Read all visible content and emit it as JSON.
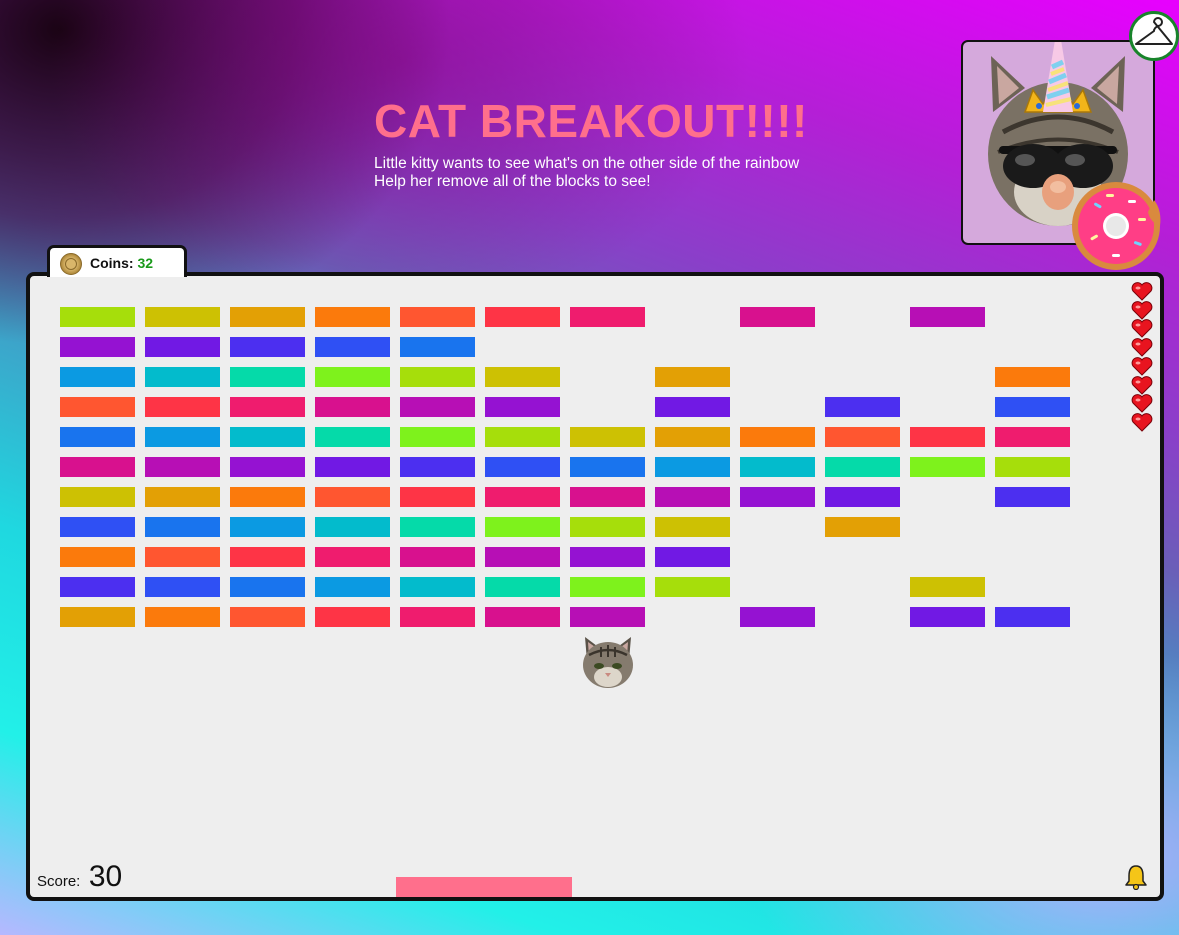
{
  "header": {
    "title": "CAT BREAKOUT!!!!",
    "subtitle_lines": [
      "Little kitty wants to see what's on the other side of the rainbow",
      "Help her remove all of the blocks to see!"
    ]
  },
  "portrait": {
    "icon": "unicorn-cat-icon",
    "bg_color": "#d5a9dc"
  },
  "wardrobe_button": {
    "icon": "hanger-icon",
    "border_color": "#18842b"
  },
  "donut": {
    "icon": "donut-icon"
  },
  "coins": {
    "label": "Coins:",
    "count": "32",
    "icon": "coin-icon",
    "count_color": "#1a9a1a"
  },
  "game": {
    "ball": {
      "icon": "cat-face-icon"
    },
    "paddle_color": "#ff6f8c",
    "lives": 8,
    "score_label": "Score:",
    "score": "30",
    "sound_icon": "bell-icon",
    "bricks": [
      [
        "#a6de0b",
        "#cdc103",
        "#e3a005",
        "#fb7a0c",
        "#ff5630",
        "#fe3446",
        "#ef1c6e",
        null,
        "#d8118e",
        null,
        "#b70fb5",
        null
      ],
      [
        "#9512d2",
        "#7119e4",
        "#4c2ff0",
        "#2f50f4",
        "#1974ee",
        null,
        null,
        null,
        null,
        null,
        null,
        null
      ],
      [
        "#0b9ae2",
        "#03bbcc",
        "#05daa9",
        "#7ef21c",
        "#a6de0b",
        "#cdc103",
        null,
        "#e3a005",
        null,
        null,
        null,
        "#fb7a0c"
      ],
      [
        "#ff5630",
        "#fe3446",
        "#ef1c6e",
        "#d8118e",
        "#b70fb5",
        "#9512d2",
        null,
        "#7119e4",
        null,
        "#4c2ff0",
        null,
        "#2f50f4"
      ],
      [
        "#1974ee",
        "#0b9ae2",
        "#03bbcc",
        "#05daa9",
        "#7ef21c",
        "#a6de0b",
        "#cdc103",
        "#e3a005",
        "#fb7a0c",
        "#ff5630",
        "#fe3446",
        "#ef1c6e"
      ],
      [
        "#d8118e",
        "#b70fb5",
        "#9512d2",
        "#7119e4",
        "#4c2ff0",
        "#2f50f4",
        "#1974ee",
        "#0b9ae2",
        "#03bbcc",
        "#05daa9",
        "#7ef21c",
        "#a6de0b"
      ],
      [
        "#cdc103",
        "#e3a005",
        "#fb7a0c",
        "#ff5630",
        "#fe3446",
        "#ef1c6e",
        "#d8118e",
        "#b70fb5",
        "#9512d2",
        "#7119e4",
        null,
        "#4c2ff0"
      ],
      [
        "#2f50f4",
        "#1974ee",
        "#0b9ae2",
        "#03bbcc",
        "#05daa9",
        "#7ef21c",
        "#a6de0b",
        "#cdc103",
        null,
        "#e3a005",
        null,
        null
      ],
      [
        "#fb7a0c",
        "#ff5630",
        "#fe3446",
        "#ef1c6e",
        "#d8118e",
        "#b70fb5",
        "#9512d2",
        "#7119e4",
        null,
        null,
        null,
        null
      ],
      [
        "#4c2ff0",
        "#2f50f4",
        "#1974ee",
        "#0b9ae2",
        "#03bbcc",
        "#05daa9",
        "#7ef21c",
        "#a6de0b",
        null,
        null,
        "#cdc103",
        null
      ],
      [
        "#e3a005",
        "#fb7a0c",
        "#ff5630",
        "#fe3446",
        "#ef1c6e",
        "#d8118e",
        "#b70fb5",
        null,
        "#9512d2",
        null,
        "#7119e4",
        "#4c2ff0"
      ]
    ]
  }
}
